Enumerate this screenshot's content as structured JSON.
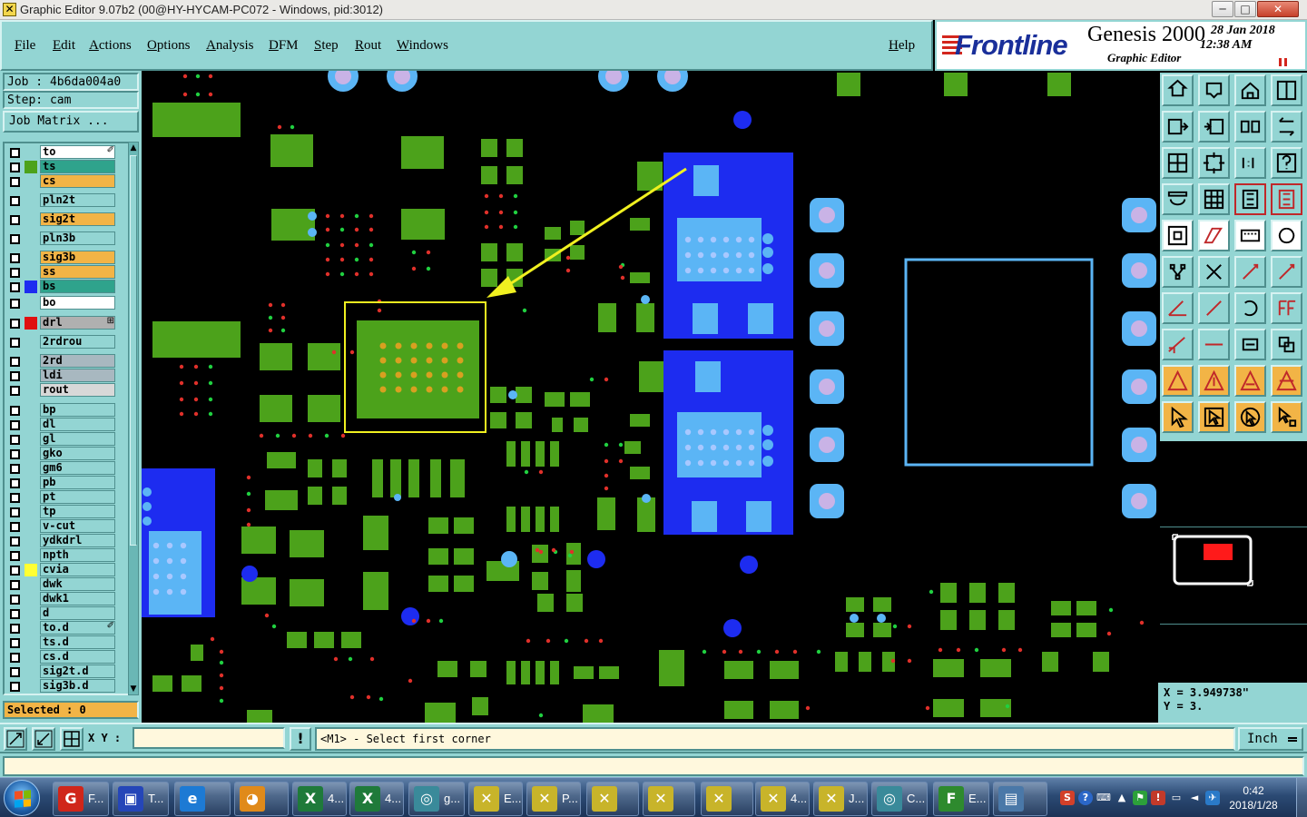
{
  "window": {
    "title": "Graphic Editor 9.07b2 (00@HY-HYCAM-PC072 - Windows, pid:3012)",
    "controls": {
      "minimize": "─",
      "maximize": "□",
      "close": "✕"
    }
  },
  "menu": [
    "File",
    "Edit",
    "Actions",
    "Options",
    "Analysis",
    "DFM",
    "Step",
    "Rout",
    "Windows",
    "Help"
  ],
  "brand": {
    "logo": "Frontline",
    "product": "Genesis 2000",
    "subtitle": "Graphic Editor",
    "date": "28 Jan 2018",
    "time": "12:38 AM"
  },
  "job": {
    "job": "Job : 4b6da004a0",
    "step": "Step: cam",
    "matrix_button": "Job Matrix ..."
  },
  "layers": [
    {
      "name": "to",
      "color": "#ffffff",
      "swatch": "",
      "marker": "✐"
    },
    {
      "name": "ts",
      "color": "#2fa38c",
      "swatch": "#4ca21b",
      "marker": ""
    },
    {
      "name": "cs",
      "color": "#f2b446",
      "swatch": "",
      "marker": ""
    },
    {
      "name": "pln2t",
      "color": "#93d5d3",
      "swatch": "",
      "marker": ""
    },
    {
      "name": "sig2t",
      "color": "#f2b446",
      "swatch": "",
      "marker": ""
    },
    {
      "name": "pln3b",
      "color": "#93d5d3",
      "swatch": "",
      "marker": ""
    },
    {
      "name": "sig3b",
      "color": "#f2b446",
      "swatch": "",
      "marker": ""
    },
    {
      "name": "ss",
      "color": "#f2b446",
      "swatch": "",
      "marker": ""
    },
    {
      "name": "bs",
      "color": "#2fa38c",
      "swatch": "#1d2cf0",
      "marker": ""
    },
    {
      "name": "bo",
      "color": "#ffffff",
      "swatch": "",
      "marker": ""
    },
    {
      "name": "drl",
      "color": "#b0b0b0",
      "swatch": "#e01010",
      "marker": "⊞"
    },
    {
      "name": "2rdrou",
      "color": "#93d5d3",
      "swatch": "",
      "marker": ""
    },
    {
      "name": "2rd",
      "color": "#a8b8c0",
      "swatch": "",
      "marker": ""
    },
    {
      "name": "ldi",
      "color": "#a8b8c0",
      "swatch": "",
      "marker": ""
    },
    {
      "name": "rout",
      "color": "#d8d8d8",
      "swatch": "",
      "marker": ""
    },
    {
      "name": "bp",
      "color": "#93d5d3",
      "swatch": "",
      "marker": ""
    },
    {
      "name": "dl",
      "color": "#93d5d3",
      "swatch": "",
      "marker": ""
    },
    {
      "name": "gl",
      "color": "#93d5d3",
      "swatch": "",
      "marker": ""
    },
    {
      "name": "gko",
      "color": "#93d5d3",
      "swatch": "",
      "marker": ""
    },
    {
      "name": "gm6",
      "color": "#93d5d3",
      "swatch": "",
      "marker": ""
    },
    {
      "name": "pb",
      "color": "#93d5d3",
      "swatch": "",
      "marker": ""
    },
    {
      "name": "pt",
      "color": "#93d5d3",
      "swatch": "",
      "marker": ""
    },
    {
      "name": "tp",
      "color": "#93d5d3",
      "swatch": "",
      "marker": ""
    },
    {
      "name": "v-cut",
      "color": "#93d5d3",
      "swatch": "",
      "marker": ""
    },
    {
      "name": "ydkdrl",
      "color": "#93d5d3",
      "swatch": "",
      "marker": ""
    },
    {
      "name": "npth",
      "color": "#93d5d3",
      "swatch": "",
      "marker": ""
    },
    {
      "name": "cvia",
      "color": "#93d5d3",
      "swatch": "#ffff33",
      "marker": ""
    },
    {
      "name": "dwk",
      "color": "#93d5d3",
      "swatch": "",
      "marker": ""
    },
    {
      "name": "dwk1",
      "color": "#93d5d3",
      "swatch": "",
      "marker": ""
    },
    {
      "name": "d",
      "color": "#93d5d3",
      "swatch": "",
      "marker": ""
    },
    {
      "name": "to.d",
      "color": "#93d5d3",
      "swatch": "",
      "marker": "✐"
    },
    {
      "name": "ts.d",
      "color": "#93d5d3",
      "swatch": "",
      "marker": ""
    },
    {
      "name": "cs.d",
      "color": "#93d5d3",
      "swatch": "",
      "marker": ""
    },
    {
      "name": "sig2t.d",
      "color": "#93d5d3",
      "swatch": "",
      "marker": ""
    },
    {
      "name": "sig3b.d",
      "color": "#93d5d3",
      "swatch": "",
      "marker": ""
    }
  ],
  "selected": "Selected : 0",
  "coords": {
    "x": "X = 3.949738\"",
    "y": "Y = 3."
  },
  "command": {
    "xy_label": "X Y :",
    "xy_value": "",
    "warn": "!",
    "prompt": "<M1> - Select first corner",
    "units": "Inch"
  },
  "tools": [
    "open-job",
    "save",
    "home",
    "window-split",
    "pan-left",
    "pan-right",
    "flip",
    "swap",
    "zoom-fit",
    "zoom-home",
    "zoom-1to1",
    "help",
    "ruler-settings",
    "grid",
    "layer-compare",
    "layer-compare-red",
    "pad-select",
    "polygon-edit",
    "pattern-fill",
    "circle-fill",
    "net-select",
    "cross",
    "line-to-pad",
    "line-to-pad-red",
    "line-angle",
    "line-diagonal",
    "arc",
    "text-ff",
    "pad-snap",
    "line-snap",
    "measure-box",
    "copy-pads",
    "triangle-a",
    "triangle-b",
    "triangle-c",
    "triangle-d",
    "pointer",
    "pointer-box",
    "pointer-circle",
    "pointer-net"
  ],
  "colors": {
    "panel": "#93d5d3",
    "pad_green": "#4ca21b",
    "copper_blue": "#1d2cf0",
    "light_blue": "#5bb5f5",
    "highlight_yellow": "#f0f020",
    "drill_red": "#d83a2a"
  },
  "taskbar": {
    "items": [
      {
        "label": "F...",
        "icon": "G",
        "color": "#d0261a"
      },
      {
        "label": "T...",
        "icon": "▣",
        "color": "#2546b8"
      },
      {
        "label": "",
        "icon": "e",
        "color": "#1d7ad4"
      },
      {
        "label": "",
        "icon": "◕",
        "color": "#e08a1a"
      },
      {
        "label": "4...",
        "icon": "X",
        "color": "#1f7a3a"
      },
      {
        "label": "4...",
        "icon": "X",
        "color": "#1f7a3a"
      },
      {
        "label": "g...",
        "icon": "◎",
        "color": "#3a8a9a"
      },
      {
        "label": "E...",
        "icon": "✕",
        "color": "#c8b42a"
      },
      {
        "label": "P...",
        "icon": "✕",
        "color": "#c8b42a"
      },
      {
        "label": "",
        "icon": "✕",
        "color": "#c8b42a"
      },
      {
        "label": "",
        "icon": "✕",
        "color": "#c8b42a"
      },
      {
        "label": "",
        "icon": "✕",
        "color": "#c8b42a"
      },
      {
        "label": "4...",
        "icon": "✕",
        "color": "#c8b42a"
      },
      {
        "label": "J...",
        "icon": "✕",
        "color": "#c8b42a"
      },
      {
        "label": "C...",
        "icon": "◎",
        "color": "#3a8a9a"
      },
      {
        "label": "E...",
        "icon": "F",
        "color": "#2e8a2e"
      },
      {
        "label": "",
        "icon": "▤",
        "color": "#4a78a8"
      }
    ],
    "clock_time": "0:42",
    "clock_date": "2018/1/28"
  }
}
